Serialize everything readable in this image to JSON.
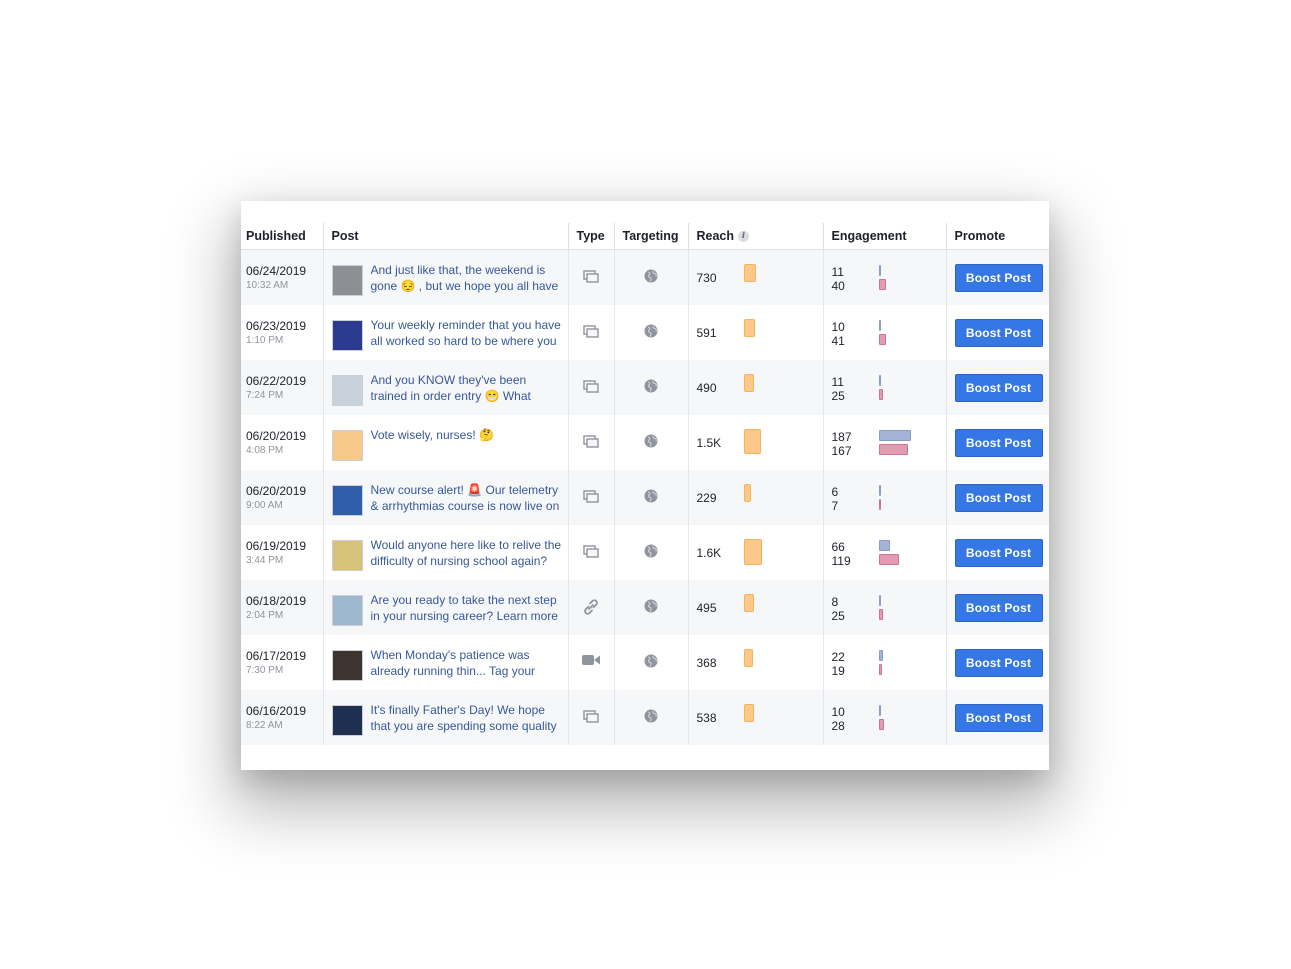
{
  "headers": {
    "published": "Published",
    "post": "Post",
    "type": "Type",
    "targeting": "Targeting",
    "reach": "Reach",
    "engagement": "Engagement",
    "promote": "Promote"
  },
  "icons": {
    "reach_info": "info-icon",
    "targeting": "globe-icon",
    "type_photo": "photo-album-icon",
    "type_link": "link-icon",
    "type_video": "video-camera-icon"
  },
  "colors": {
    "boost_button": "#3578e5",
    "post_link": "#365899",
    "reach_bar": "#fcc98b",
    "engagement_clicks": "#a5b4d6",
    "engagement_reactions": "#e29bb0"
  },
  "rows": [
    {
      "date": "06/24/2019",
      "time": "10:32 AM",
      "text": "And just like that, the weekend is gone 😔 , but we hope you all have",
      "type": "photo",
      "reach": "730",
      "reach_value": 730,
      "eng_top": "11",
      "eng_bottom": "40",
      "thumb": "#8c8f94",
      "button": "Boost Post"
    },
    {
      "date": "06/23/2019",
      "time": "1:10 PM",
      "text": "Your weekly reminder that you have all worked so hard to be where you",
      "type": "photo",
      "reach": "591",
      "reach_value": 591,
      "eng_top": "10",
      "eng_bottom": "41",
      "thumb": "#2a3a8f",
      "button": "Boost Post"
    },
    {
      "date": "06/22/2019",
      "time": "7:24 PM",
      "text": "And you KNOW they've been trained in order entry 😁 What other",
      "type": "photo",
      "reach": "490",
      "reach_value": 490,
      "eng_top": "11",
      "eng_bottom": "25",
      "thumb": "#c9d2db",
      "button": "Boost Post"
    },
    {
      "date": "06/20/2019",
      "time": "4:08 PM",
      "text": "Vote wisely, nurses! 🤔",
      "type": "photo",
      "reach": "1.5K",
      "reach_value": 1500,
      "eng_top": "187",
      "eng_bottom": "167",
      "thumb": "#f6c98a",
      "button": "Boost Post"
    },
    {
      "date": "06/20/2019",
      "time": "9:00 AM",
      "text": "New course alert! 🚨 Our telemetry & arrhythmias course is now live on",
      "type": "photo",
      "reach": "229",
      "reach_value": 229,
      "eng_top": "6",
      "eng_bottom": "7",
      "thumb": "#2f5fa8",
      "button": "Boost Post"
    },
    {
      "date": "06/19/2019",
      "time": "3:44 PM",
      "text": "Would anyone here like to relive the difficulty of nursing school again?",
      "type": "photo",
      "reach": "1.6K",
      "reach_value": 1600,
      "eng_top": "66",
      "eng_bottom": "119",
      "thumb": "#d8c27a",
      "button": "Boost Post"
    },
    {
      "date": "06/18/2019",
      "time": "2:04 PM",
      "text": "Are you ready to take the next step in your nursing career? Learn more",
      "type": "link",
      "reach": "495",
      "reach_value": 495,
      "eng_top": "8",
      "eng_bottom": "25",
      "thumb": "#9fb8cf",
      "button": "Boost Post"
    },
    {
      "date": "06/17/2019",
      "time": "7:30 PM",
      "text": "When Monday's patience was already running thin... Tag your",
      "type": "video",
      "reach": "368",
      "reach_value": 368,
      "eng_top": "22",
      "eng_bottom": "19",
      "thumb": "#3d3430",
      "button": "Boost Post"
    },
    {
      "date": "06/16/2019",
      "time": "8:22 AM",
      "text": "It's finally Father's Day! We hope that you are spending some quality",
      "type": "photo",
      "reach": "538",
      "reach_value": 538,
      "eng_top": "10",
      "eng_bottom": "28",
      "thumb": "#1e2f4f",
      "button": "Boost Post"
    }
  ]
}
